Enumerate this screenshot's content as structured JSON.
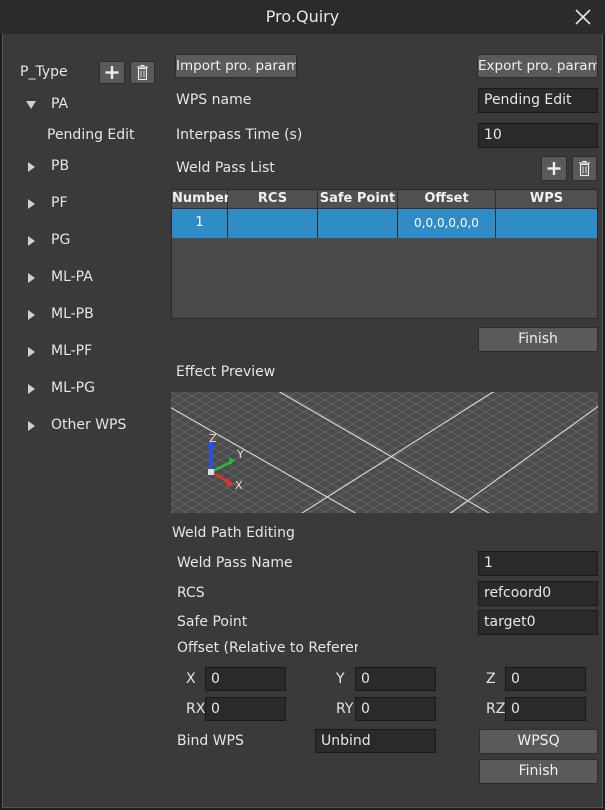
{
  "window": {
    "title": "Pro.Quiry"
  },
  "sidebar": {
    "header": "P_Type",
    "items": [
      {
        "label": "PA",
        "expanded": true,
        "children": [
          "Pending Edit"
        ]
      },
      {
        "label": "PB"
      },
      {
        "label": "PF"
      },
      {
        "label": "PG"
      },
      {
        "label": "ML-PA"
      },
      {
        "label": "ML-PB"
      },
      {
        "label": "ML-PF"
      },
      {
        "label": "ML-PG"
      },
      {
        "label": "Other WPS"
      }
    ]
  },
  "main": {
    "import_label": "Import pro. param.",
    "export_label": "Export pro. param.",
    "wps_name_label": "WPS name",
    "wps_name_value": "Pending Edit",
    "interpass_label": "Interpass Time (s)",
    "interpass_value": "10",
    "pass_list_label": "Weld Pass List",
    "table": {
      "columns": [
        "Number",
        "RCS",
        "Safe Point",
        "Offset",
        "WPS"
      ],
      "rows": [
        [
          "1",
          "",
          "",
          "0,0,0,0,0,0",
          ""
        ]
      ]
    },
    "finish_label": "Finish",
    "preview_label": "Effect Preview",
    "axes": {
      "x": "X",
      "y": "Y",
      "z": "Z"
    }
  },
  "path_edit": {
    "section_label": "Weld Path Editing",
    "pass_name_label": "Weld Pass Name",
    "pass_name_value": "1",
    "rcs_label": "RCS",
    "rcs_value": "refcoord0",
    "safe_point_label": "Safe Point",
    "safe_point_value": "target0",
    "offset_label": "Offset (Relative to Referer",
    "x_label": "X",
    "x_value": "0",
    "y_label": "Y",
    "y_value": "0",
    "z_label": "Z",
    "z_value": "0",
    "rx_label": "RX",
    "rx_value": "0",
    "ry_label": "RY",
    "ry_value": "0",
    "rz_label": "RZ",
    "rz_value": "0",
    "bind_label": "Bind WPS",
    "bind_value": "Unbind",
    "wpsq_label": "WPSQ",
    "finish_label": "Finish"
  },
  "colors": {
    "selection": "#308cc6",
    "background": "#3a3a3a"
  }
}
